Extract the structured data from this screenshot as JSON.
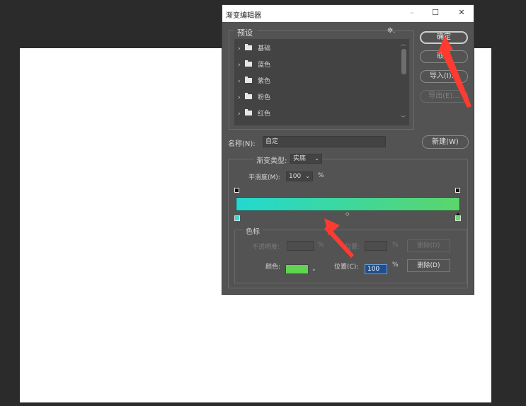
{
  "dialog": {
    "title": "渐变编辑器",
    "controls": {
      "minimize": "–",
      "maximize": "☐",
      "close": "✕"
    }
  },
  "presets": {
    "label": "预设",
    "gear": "✲.",
    "items": [
      {
        "label": "基础"
      },
      {
        "label": "蓝色"
      },
      {
        "label": "紫色"
      },
      {
        "label": "粉色"
      },
      {
        "label": "红色"
      }
    ]
  },
  "buttons": {
    "ok": "确定",
    "cancel": "取消",
    "import": "导入(I)...",
    "export": "导出(E)..."
  },
  "name": {
    "label": "名称(N):",
    "value": "自定",
    "new_button": "新建(W)"
  },
  "gradient": {
    "type_label": "渐变类型:",
    "type_value": "实底",
    "smoothness_label": "平滑度(M):",
    "smoothness_value": "100",
    "percent": "%",
    "colors": {
      "start": "#22d9cf",
      "end": "#5bd66a"
    }
  },
  "color_stops": {
    "label": "色标",
    "opacity_label": "不透明度:",
    "opacity_pct": "%",
    "position_label_top": "位置:",
    "position_pct_top": "%",
    "delete_top": "删除(D)",
    "color_label": "颜色:",
    "color_value": "#5fd44f",
    "position_label": "位置(C):",
    "position_value": "100",
    "position_pct": "%",
    "delete_bottom": "删除(D)"
  }
}
